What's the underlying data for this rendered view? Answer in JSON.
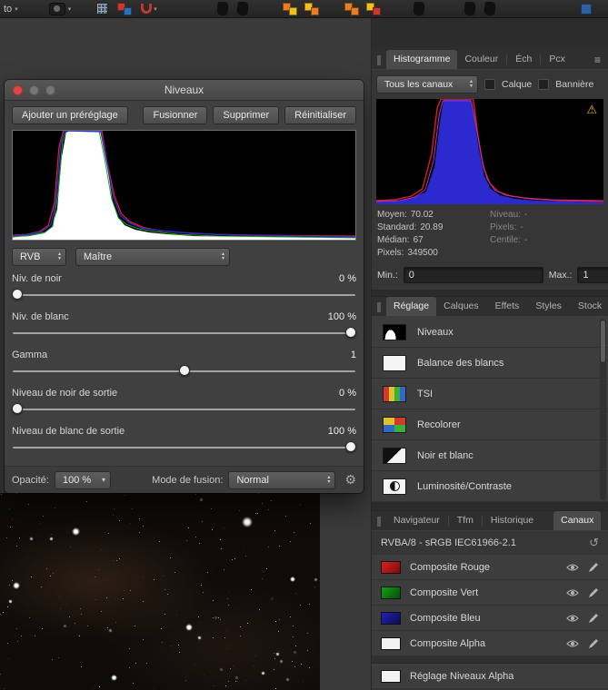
{
  "icons": {
    "caret_up": "▴",
    "caret_down": "▾",
    "gear": "⚙",
    "warning": "⚠",
    "menu": "≡",
    "reset": "↺"
  },
  "window": {
    "toolbar_label": "to"
  },
  "levels_dialog": {
    "title": "Niveaux",
    "add_preset": "Ajouter un préréglage",
    "merge": "Fusionner",
    "delete": "Supprimer",
    "reset": "Réinitialiser",
    "channel_value": "RVB",
    "master_value": "Maître",
    "sliders": [
      {
        "label": "Niv. de noir",
        "value": "0 %"
      },
      {
        "label": "Niv. de blanc",
        "value": "100 %"
      },
      {
        "label": "Gamma",
        "value": "1"
      },
      {
        "label": "Niveau de noir de sortie",
        "value": "0 %"
      },
      {
        "label": "Niveau de blanc de sortie",
        "value": "100 %"
      }
    ],
    "opacity_label": "Opacité:",
    "opacity_value": "100 %",
    "blend_label": "Mode de fusion:",
    "blend_value": "Normal"
  },
  "histogram_panel": {
    "tabs": [
      "Histogramme",
      "Couleur",
      "Éch",
      "Pcx"
    ],
    "channels_value": "Tous les canaux",
    "calque_label": "Calque",
    "banner_label": "Bannière",
    "stats_left": [
      {
        "label": "Moyen:",
        "value": "70.02"
      },
      {
        "label": "Standard:",
        "value": "20.89"
      },
      {
        "label": "Médian:",
        "value": "67"
      },
      {
        "label": "Pixels:",
        "value": "349500"
      }
    ],
    "stats_right": [
      {
        "label": "Niveau:",
        "value": "-"
      },
      {
        "label": "Pixels:",
        "value": "-"
      },
      {
        "label": "Centile:",
        "value": "-"
      }
    ],
    "min_label": "Min.:",
    "min_value": "0",
    "max_label": "Max.:",
    "max_value": "1"
  },
  "adjust_panel": {
    "tabs": [
      "Réglage",
      "Calques",
      "Effets",
      "Styles",
      "Stock"
    ],
    "items": [
      "Niveaux",
      "Balance des blancs",
      "TSI",
      "Recolorer",
      "Noir et blanc",
      "Luminosité/Contraste"
    ]
  },
  "channels_panel": {
    "tabs": [
      "Navigateur",
      "Tfm",
      "Historique",
      "Canaux"
    ],
    "colorspace": "RVBA/8 - sRGB IEC61966-2.1",
    "channels": [
      "Composite Rouge",
      "Composite Vert",
      "Composite Bleu",
      "Composite Alpha"
    ],
    "adjustment_channel": "Réglage Niveaux Alpha"
  },
  "histograms": {
    "levels": {
      "white": "0,122 0,119 18,118 34,115 44,108 50,88 55,30 60,2 64,0 98,0 102,12 107,45 112,78 118,97 126,106 138,111 154,114 175,116 205,118 385,120 385,122",
      "red": "0,117 16,116 30,113 40,106 47,80 52,18 57,0 100,0 106,35 114,72 122,93 132,102 146,108 165,112 190,114 225,116 280,117 385,118",
      "green": "0,119 20,117 36,114 45,107 51,70 56,12 60,0 97,0 103,30 111,76 119,98 128,105 142,110 160,113 185,116 230,118 385,120",
      "blue": "0,118 18,116 33,113 43,105 49,75 54,14 58,0 99,1 105,32 113,74 121,95 131,103 145,109 168,112 200,115 260,117 385,119"
    },
    "panel": {
      "blue": "0,116 0,113 22,112 40,109 54,102 63,75 69,25 73,0 102,0 106,20 111,55 117,85 124,99 134,106 150,110 175,112 210,113 246,114 246,116",
      "red": "0,112 20,111 38,107 50,99 60,60 66,10 70,0 105,0 110,40 116,75 123,93 132,102 146,107 168,110 200,112 246,113",
      "magenta": "0,113 25,112 42,108 53,100 62,68 68,18 72,2 103,2 108,30 114,65 120,88 128,100 140,106 160,109 190,111 246,112"
    }
  },
  "colors": {
    "warning": "#e7b421",
    "tab_selected_bg": "#4a4a4a"
  }
}
